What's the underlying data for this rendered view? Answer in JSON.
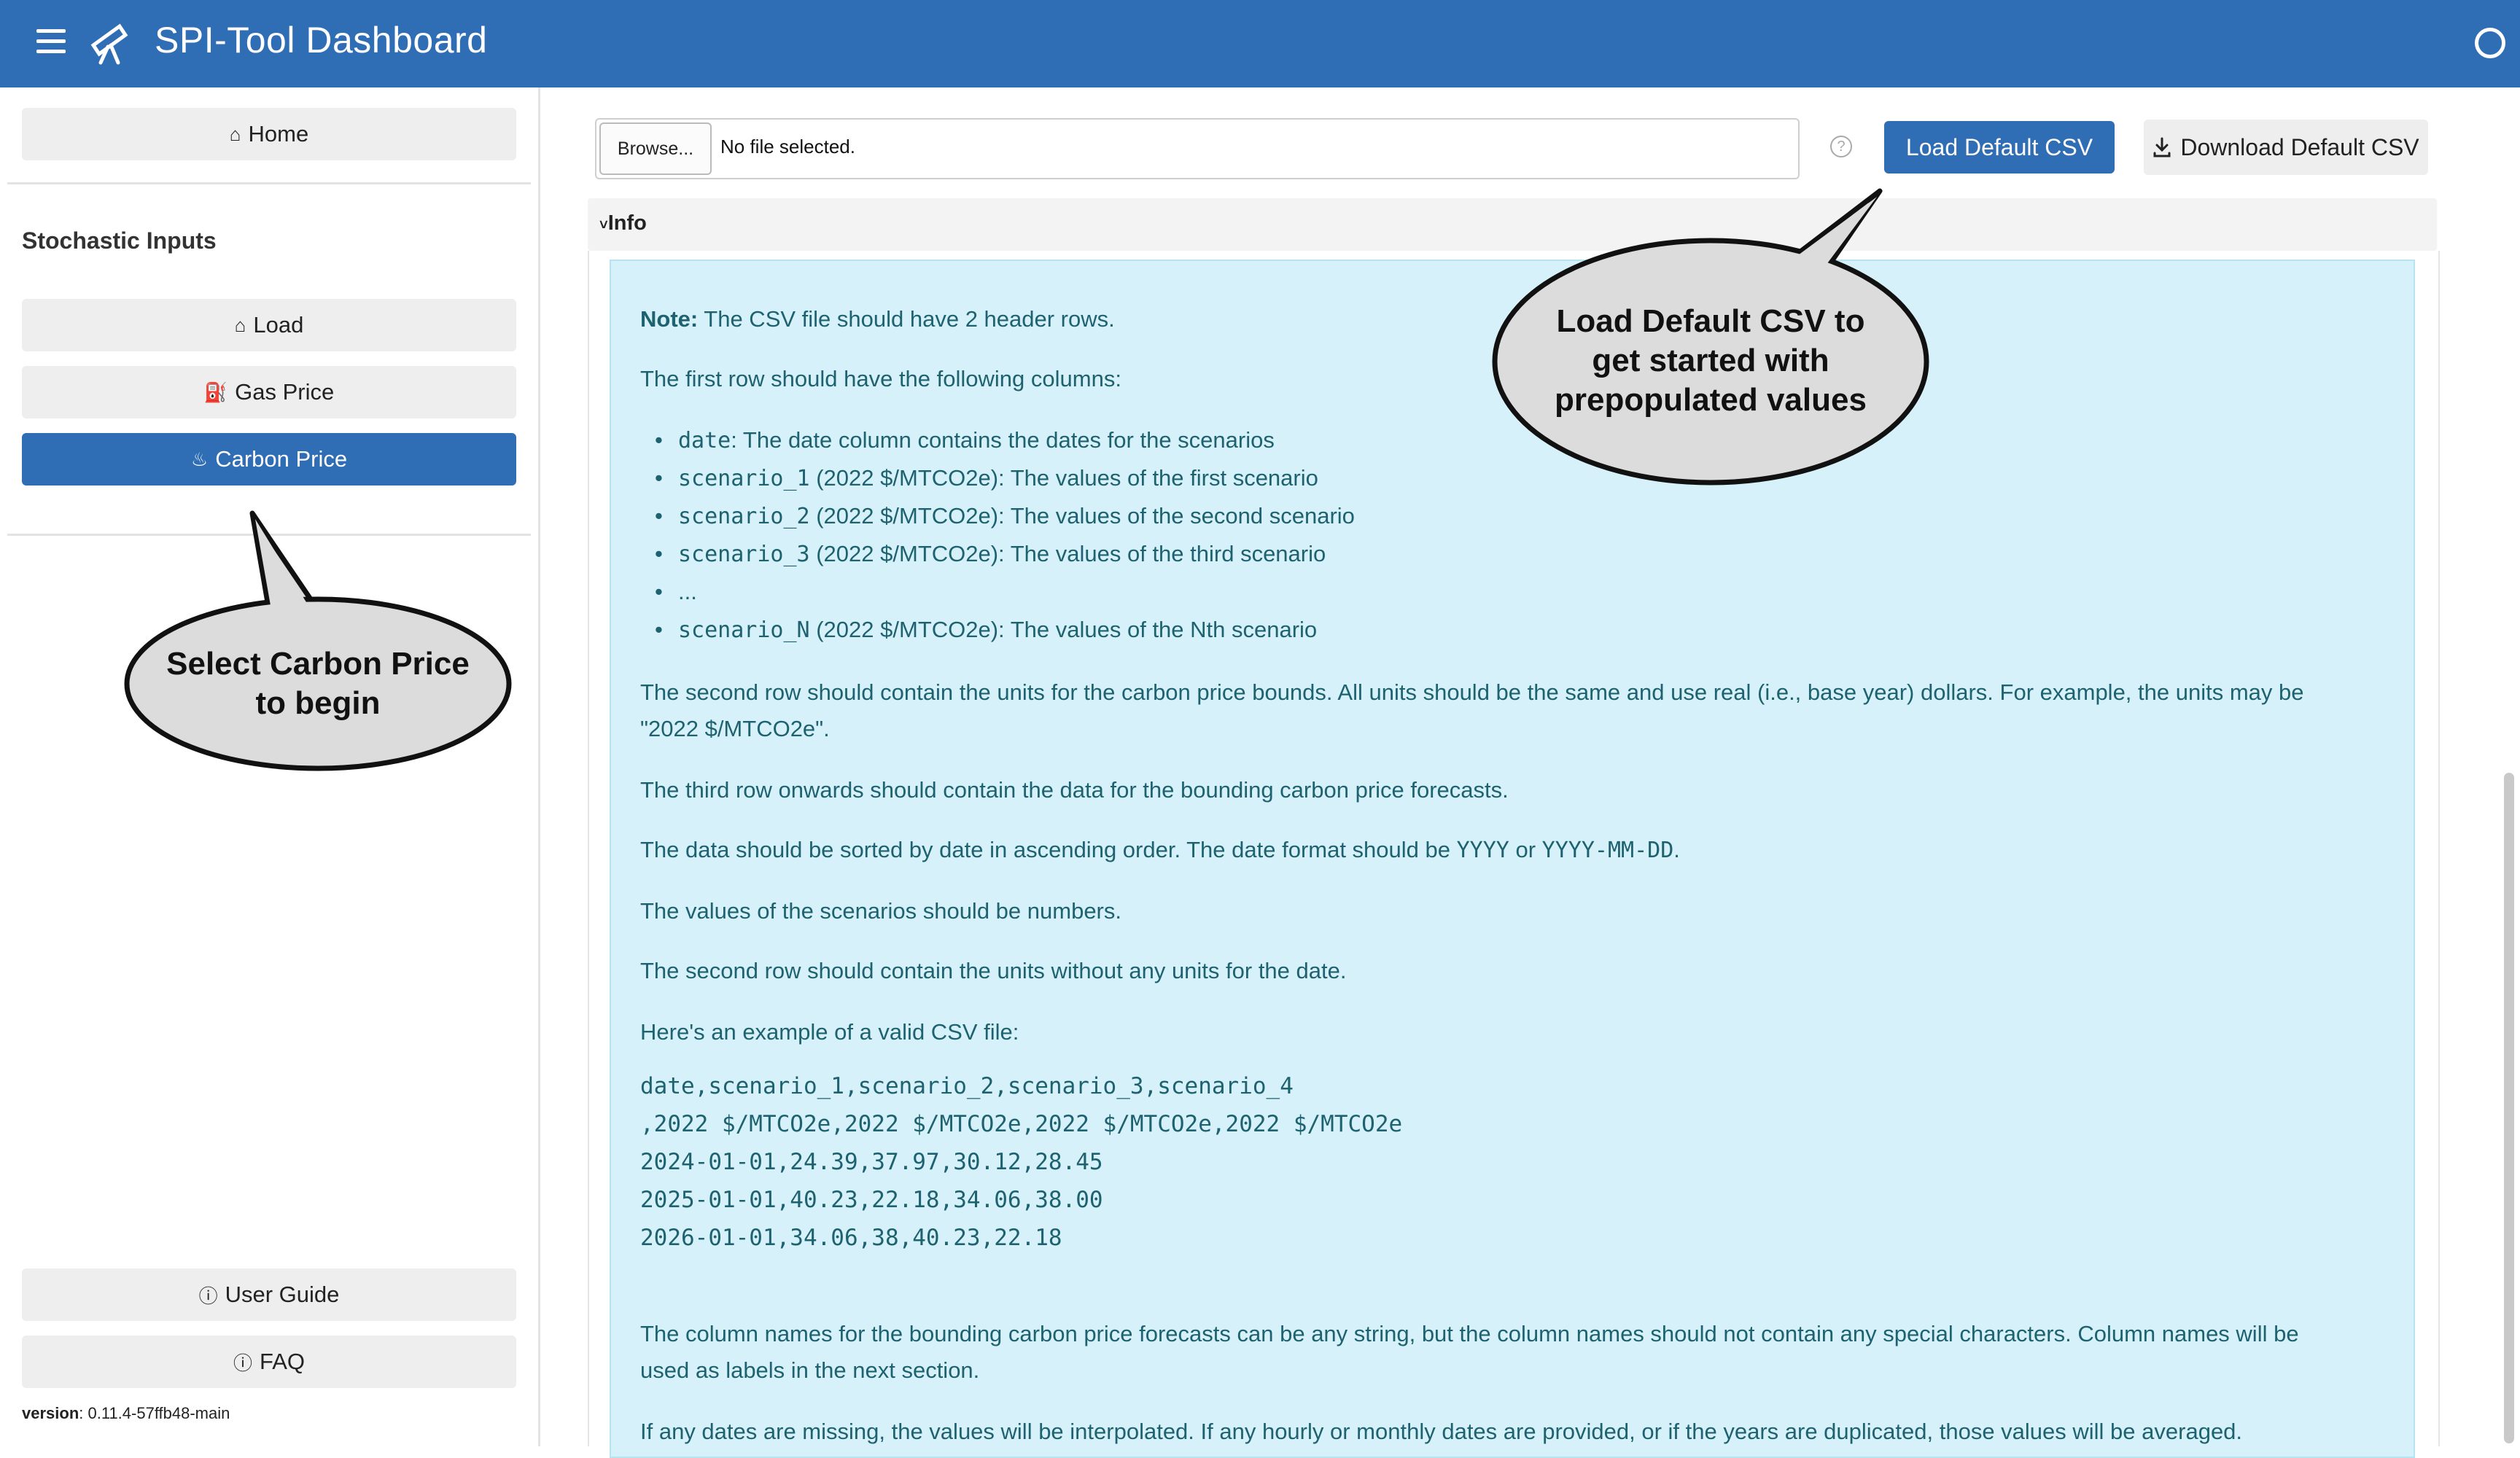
{
  "header": {
    "title": "SPI-Tool Dashboard",
    "menu_icon": "hamburger-icon",
    "logo_icon": "telescope-icon",
    "status_icon": "circle-icon"
  },
  "sidebar": {
    "home_label": "Home",
    "section_title": "Stochastic Inputs",
    "items": [
      {
        "label": "Load",
        "icon": "home-icon"
      },
      {
        "label": "Gas Price",
        "icon": "gas-pump-icon"
      },
      {
        "label": "Carbon Price",
        "icon": "flame-icon",
        "active": true
      }
    ],
    "user_guide_label": "User Guide",
    "faq_label": "FAQ",
    "version_label": "version",
    "version_value": ": 0.11.4-57ffb48-main"
  },
  "upload": {
    "browse_label": "Browse...",
    "file_status": "No file selected.",
    "help_symbol": "?",
    "load_default_label": "Load Default CSV",
    "download_default_label": "Download Default CSV"
  },
  "info": {
    "toggle_label": "Info",
    "note_label": "Note:",
    "note_text": " The CSV file should have 2 header rows.",
    "first_row_intro": "The first row should have the following columns:",
    "columns": [
      {
        "code": "date",
        "text": ": The date column contains the dates for the scenarios"
      },
      {
        "code": "scenario_1",
        "text": " (2022 $/MTCO2e): The values of the first scenario"
      },
      {
        "code": "scenario_2",
        "text": " (2022 $/MTCO2e): The values of the second scenario"
      },
      {
        "code": "scenario_3",
        "text": " (2022 $/MTCO2e): The values of the third scenario"
      },
      {
        "code": "",
        "text": "..."
      },
      {
        "code": "scenario_N",
        "text": " (2022 $/MTCO2e): The values of the Nth scenario"
      }
    ],
    "second_row_line1": "The second row should contain the units for the carbon price bounds. All units should be the same and use real (i.e., base year) dollars. For example, the units may be",
    "second_row_line2": "\"2022 $/MTCO2e\".",
    "third_row": "The third row onwards should contain the data for the bounding carbon price forecasts.",
    "sorted_prefix": "The data should be sorted by date in ascending order. The date format should be ",
    "format_yyyy": "YYYY",
    "sorted_or": " or ",
    "format_full": "YYYY-MM-DD",
    "sorted_suffix": ".",
    "numbers": "The values of the scenarios should be numbers.",
    "units_date": "The second row should contain the units without any units for the date.",
    "example_intro": "Here's an example of a valid CSV file:",
    "example_lines": [
      "date,scenario_1,scenario_2,scenario_3,scenario_4",
      ",2022 $/MTCO2e,2022 $/MTCO2e,2022 $/MTCO2e,2022 $/MTCO2e",
      "2024-01-01,24.39,37.97,30.12,28.45",
      "2025-01-01,40.23,22.18,34.06,38.00",
      "2026-01-01,34.06,38,40.23,22.18"
    ],
    "column_names_line1": "The column names for the bounding carbon price forecasts can be any string, but the column names should not contain any special characters. Column names will be",
    "column_names_line2": "used as labels in the next section.",
    "missing_dates": "If any dates are missing, the values will be interpolated. If any hourly or monthly dates are provided, or if the years are duplicated, those values will be averaged."
  },
  "callouts": {
    "load_default": [
      "Load Default CSV to",
      "get started with",
      "prepopulated values"
    ],
    "select_carbon": [
      "Select Carbon Price",
      "to begin"
    ]
  },
  "colors": {
    "header_bg": "#2f6db5",
    "accent": "#2f6db5",
    "info_bg": "#d6f1f9",
    "info_text": "#1e6270"
  }
}
